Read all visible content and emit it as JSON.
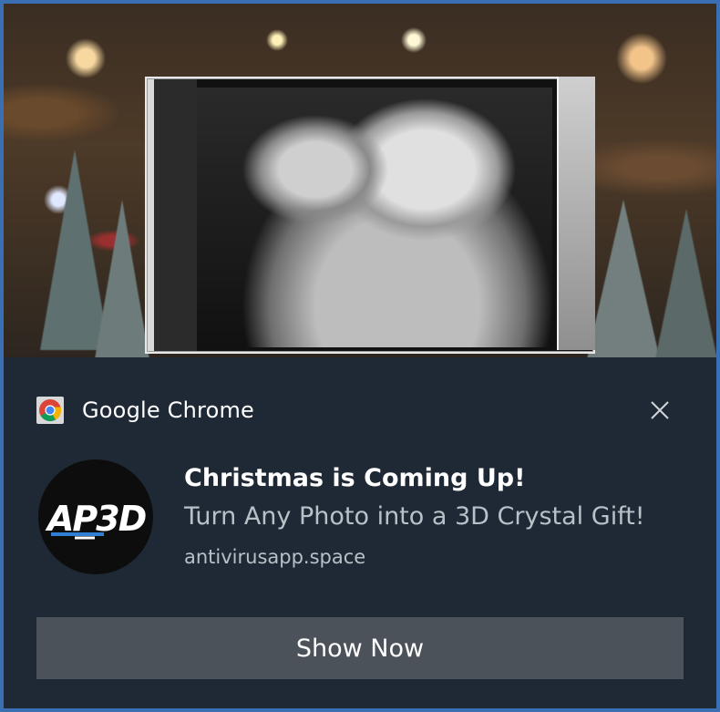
{
  "hero": {
    "image_alt": "3D crystal photo gift of mother and daughter in front of Christmas trees"
  },
  "notification": {
    "app_icon": "chrome-icon",
    "app_name": "Google Chrome",
    "close_icon": "close-icon",
    "logo_text": "AP3D",
    "title": "Christmas is Coming Up!",
    "body": "Turn Any Photo into a 3D Crystal Gift!",
    "source": "antivirusapp.space",
    "action_label": "Show Now"
  },
  "colors": {
    "frame_border": "#3b6fb3",
    "panel_bg": "#1f2935",
    "button_bg": "#4b525a",
    "secondary_text": "#b9c0c8",
    "logo_accent": "#2f7fd6"
  }
}
